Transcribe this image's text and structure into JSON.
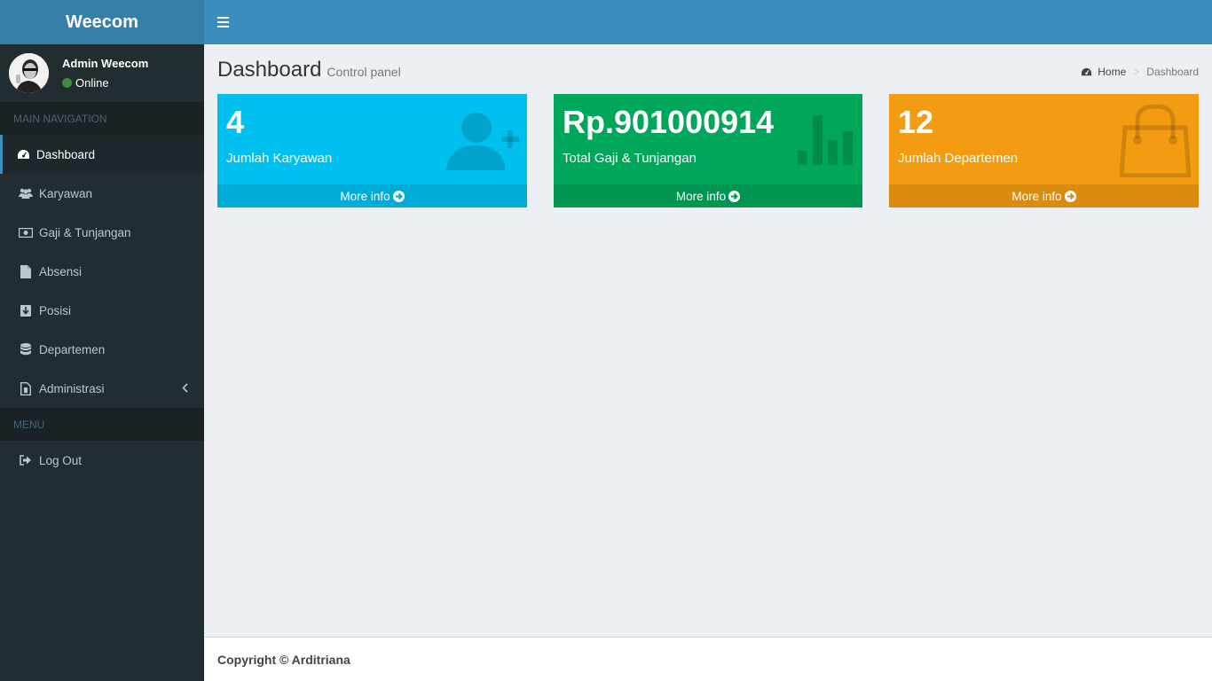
{
  "app": {
    "title": "Weecom"
  },
  "user": {
    "name": "Admin Weecom",
    "status": "Online"
  },
  "sidebar": {
    "main_header": "MAIN NAVIGATION",
    "items": [
      {
        "label": "Dashboard",
        "icon": "dashboard-icon"
      },
      {
        "label": "Karyawan",
        "icon": "users-icon"
      },
      {
        "label": "Gaji & Tunjangan",
        "icon": "money-icon"
      },
      {
        "label": "Absensi",
        "icon": "file-icon"
      },
      {
        "label": "Posisi",
        "icon": "download-icon"
      },
      {
        "label": "Departemen",
        "icon": "database-icon"
      },
      {
        "label": "Administrasi",
        "icon": "file-document-icon"
      }
    ],
    "menu_header": "MENU",
    "logout": "Log Out"
  },
  "page": {
    "title": "Dashboard",
    "subtitle": "Control panel"
  },
  "breadcrumb": {
    "home": "Home",
    "current": "Dashboard"
  },
  "boxes": [
    {
      "value": "4",
      "label": "Jumlah Karyawan",
      "footer": "More info",
      "color": "#00c0ef",
      "footer_color": "#00acd6",
      "icon": "user-plus-icon"
    },
    {
      "value": "Rp.901000914",
      "label": "Total Gaji & Tunjangan",
      "footer": "More info",
      "color": "#00a65a",
      "footer_color": "#009551",
      "icon": "bar-chart-icon"
    },
    {
      "value": "12",
      "label": "Jumlah Departemen",
      "footer": "More info",
      "color": "#f39c12",
      "footer_color": "#da8c10",
      "icon": "shopping-bag-icon"
    }
  ],
  "footer": {
    "text": "Copyright © Arditriana"
  }
}
